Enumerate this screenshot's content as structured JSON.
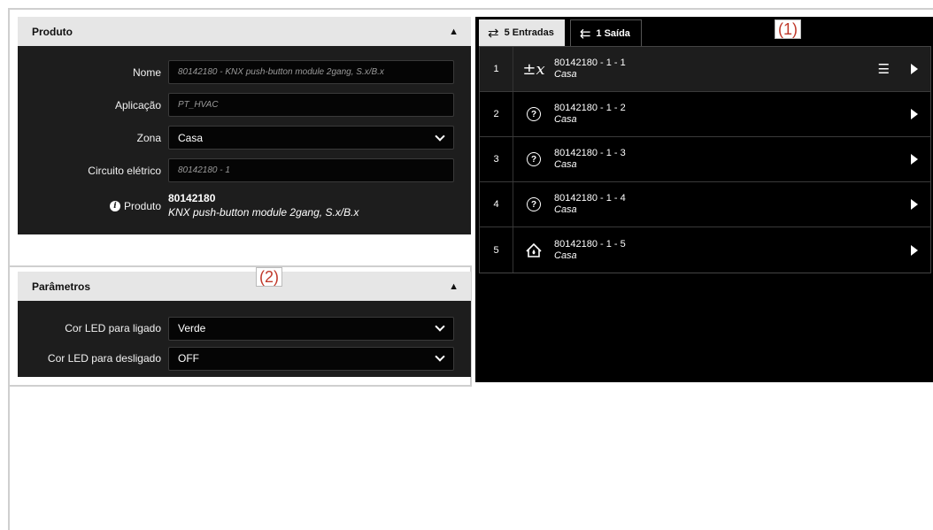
{
  "produto_panel": {
    "title": "Produto",
    "fields": {
      "nome": {
        "label": "Nome",
        "placeholder": "80142180 - KNX push-button module 2gang, S.x/B.x"
      },
      "aplicacao": {
        "label": "Aplicação",
        "placeholder": "PT_HVAC"
      },
      "zona": {
        "label": "Zona",
        "value": "Casa"
      },
      "circuito": {
        "label": "Circuito elétrico",
        "placeholder": "80142180 - 1"
      },
      "produto": {
        "label": "Produto",
        "code": "80142180",
        "description": "KNX push-button module 2gang, S.x/B.x"
      }
    }
  },
  "parametros_panel": {
    "title": "Parâmetros",
    "fields": {
      "cor_ligado": {
        "label": "Cor LED para ligado",
        "value": "Verde"
      },
      "cor_desligado": {
        "label": "Cor LED para desligado",
        "value": "OFF"
      }
    }
  },
  "annotations": {
    "one": "(1)",
    "two": "(2)"
  },
  "tabs": [
    {
      "label": "5 Entradas",
      "active": true
    },
    {
      "label": "1 Saída",
      "active": false
    }
  ],
  "inputs": [
    {
      "index": "1",
      "name": "80142180 - 1 - 1",
      "zone": "Casa",
      "icon": "function-icon"
    },
    {
      "index": "2",
      "name": "80142180 - 1 - 2",
      "zone": "Casa",
      "icon": "question-icon"
    },
    {
      "index": "3",
      "name": "80142180 - 1 - 3",
      "zone": "Casa",
      "icon": "question-icon"
    },
    {
      "index": "4",
      "name": "80142180 - 1 - 4",
      "zone": "Casa",
      "icon": "question-icon"
    },
    {
      "index": "5",
      "name": "80142180 - 1 - 5",
      "zone": "Casa",
      "icon": "home-drop-icon"
    }
  ]
}
